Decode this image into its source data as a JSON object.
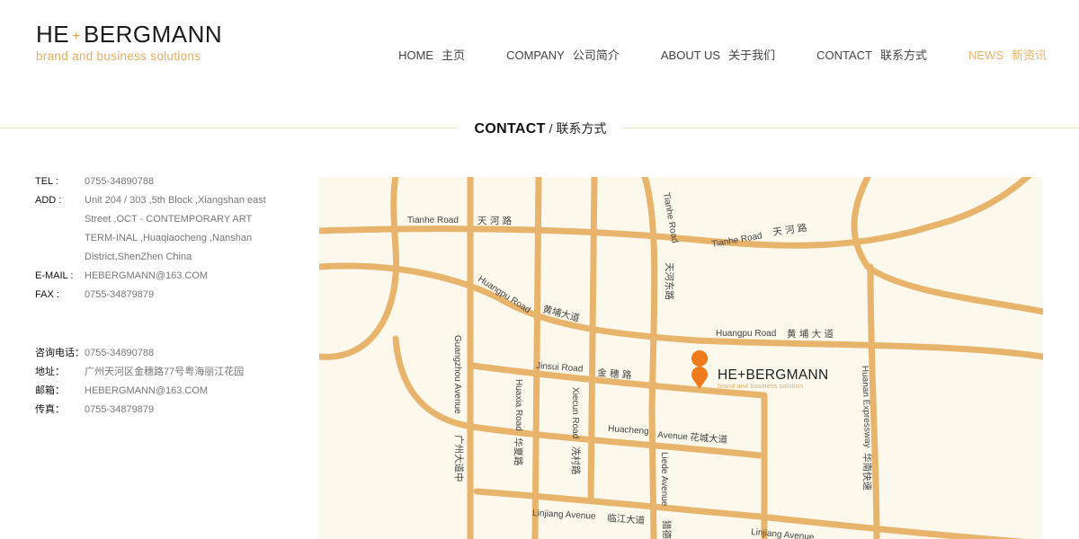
{
  "logo": {
    "part1": "HE",
    "plus": "+",
    "part2": "BERGMANN",
    "tagline": "brand and business solutions"
  },
  "nav": [
    {
      "en": "HOME",
      "cn": "主页"
    },
    {
      "en": "COMPANY",
      "cn": "公司简介"
    },
    {
      "en": "ABOUT US",
      "cn": "关于我们"
    },
    {
      "en": "CONTACT",
      "cn": "联系方式"
    },
    {
      "en": "NEWS",
      "cn": "新资讯",
      "active": true
    }
  ],
  "section": {
    "title_en": "CONTACT",
    "title_cn": "/ 联系方式"
  },
  "contact_en": [
    {
      "label": "TEL :",
      "value": "0755-34890788"
    },
    {
      "label": "ADD :",
      "value": "Unit 204 / 303 ,5th Block ,Xiangshan east Street ,OCT - CONTEMPORARY ART TERM-INAL ,Huaqiaocheng ,Nanshan District,ShenZhen China"
    },
    {
      "label": "E-MAIL :",
      "value": "HEBERGMANN@163.COM"
    },
    {
      "label": "FAX :",
      "value": "0755-34879879"
    }
  ],
  "contact_cn": [
    {
      "label": "咨询电话：",
      "value": "0755-34890788"
    },
    {
      "label": "地址：",
      "value": "广州天河区金穗路77号粤海丽江花园"
    },
    {
      "label": "邮箱：",
      "value": "HEBERGMANN@163.COM"
    },
    {
      "label": "传真：",
      "value": "0755-34879879"
    }
  ],
  "map": {
    "marker_name": "HE+BERGMANN",
    "marker_tagline": "brand and business solution",
    "labels": {
      "tianhe_road_1": "Tianhe Road",
      "tianhe_road_1_cn": "天 河 路",
      "tianhe_road_2": "Tianhe Road",
      "tianhe_road_2_cn": "天 河 路",
      "tianhe_road_v": "Tianhe Road",
      "tianhe_east_cn": "天河东路",
      "huangpu_road_1": "Huangpu Road",
      "huangpu_road_1_cn": "黄埔大道",
      "huangpu_road_2": "Huangpu Road",
      "huangpu_road_2_cn": "黄 埔 大 道",
      "jinsui_road": "Jinsui  Road",
      "jinsui_road_cn": "金 穗 路",
      "guangzhou_avenue": "Guangzhou Avenue",
      "guangzhou_avenue_cn": "广州大道中",
      "huaxia_road": "Huaxia Road",
      "huaxia_road_cn": "华夏路",
      "xiecun_road": "Xiecun Road",
      "xiecun_road_cn": "冼村路",
      "huacheng_avenue": "Huacheng",
      "huacheng_avenue_2": "Avenue",
      "huacheng_avenue_cn": "花城大道",
      "liede_avenue": "Liede Avenue",
      "liede_cn": "猎德",
      "huanan_expressway": "Huanan Expressway",
      "huanan_expressway_cn": "华南快速",
      "linjiang_avenue_1": "Linjiang Avenue",
      "linjiang_avenue_1_cn": "临江大道",
      "linjiang_avenue_2": "Linjiang Avenue"
    }
  }
}
